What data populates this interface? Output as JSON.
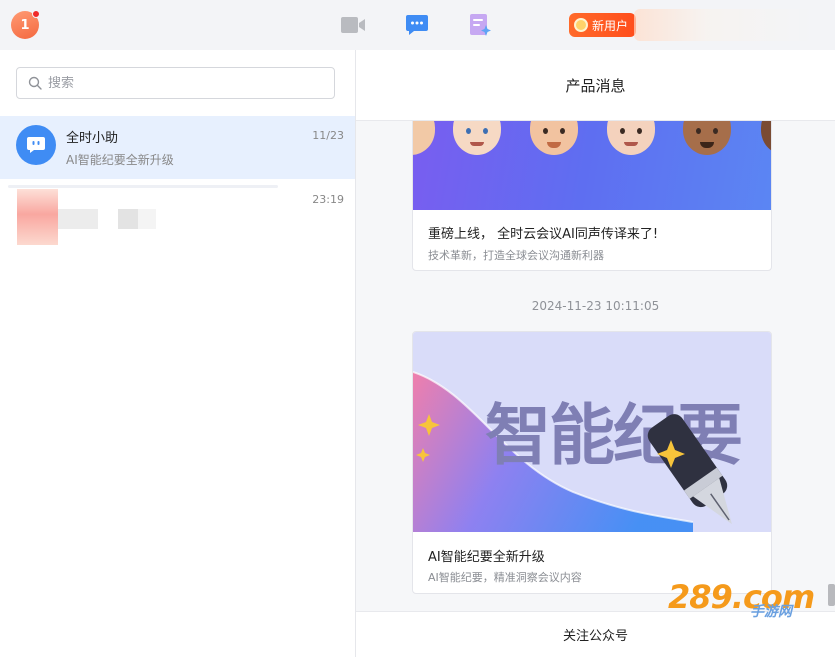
{
  "topbar": {
    "user_initial": "1",
    "new_user_label": "新用户",
    "colors": {
      "accent_orange": "#ff5a22",
      "chat_blue": "#3f8cf4"
    }
  },
  "sidebar": {
    "search_placeholder": "搜索",
    "conversations": [
      {
        "title": "全时小助",
        "subtitle": "AI智能纪要全新升级",
        "time": "11/23"
      },
      {
        "time": "23:19"
      }
    ]
  },
  "main": {
    "header_title": "产品消息",
    "messages": [
      {
        "title": "重磅上线， 全时云会议AI同声传译来了!",
        "desc": "技术革新，打造全球会议沟通新利器"
      },
      {
        "timestamp": "2024-11-23 10:11:05"
      },
      {
        "banner_text": "智能纪要",
        "title": "AI智能纪要全新升级",
        "desc": "AI智能纪要，精准洞察会议内容"
      }
    ],
    "footer_label": "关注公众号"
  },
  "watermark": {
    "main": "289.com",
    "sub": "手游网"
  }
}
